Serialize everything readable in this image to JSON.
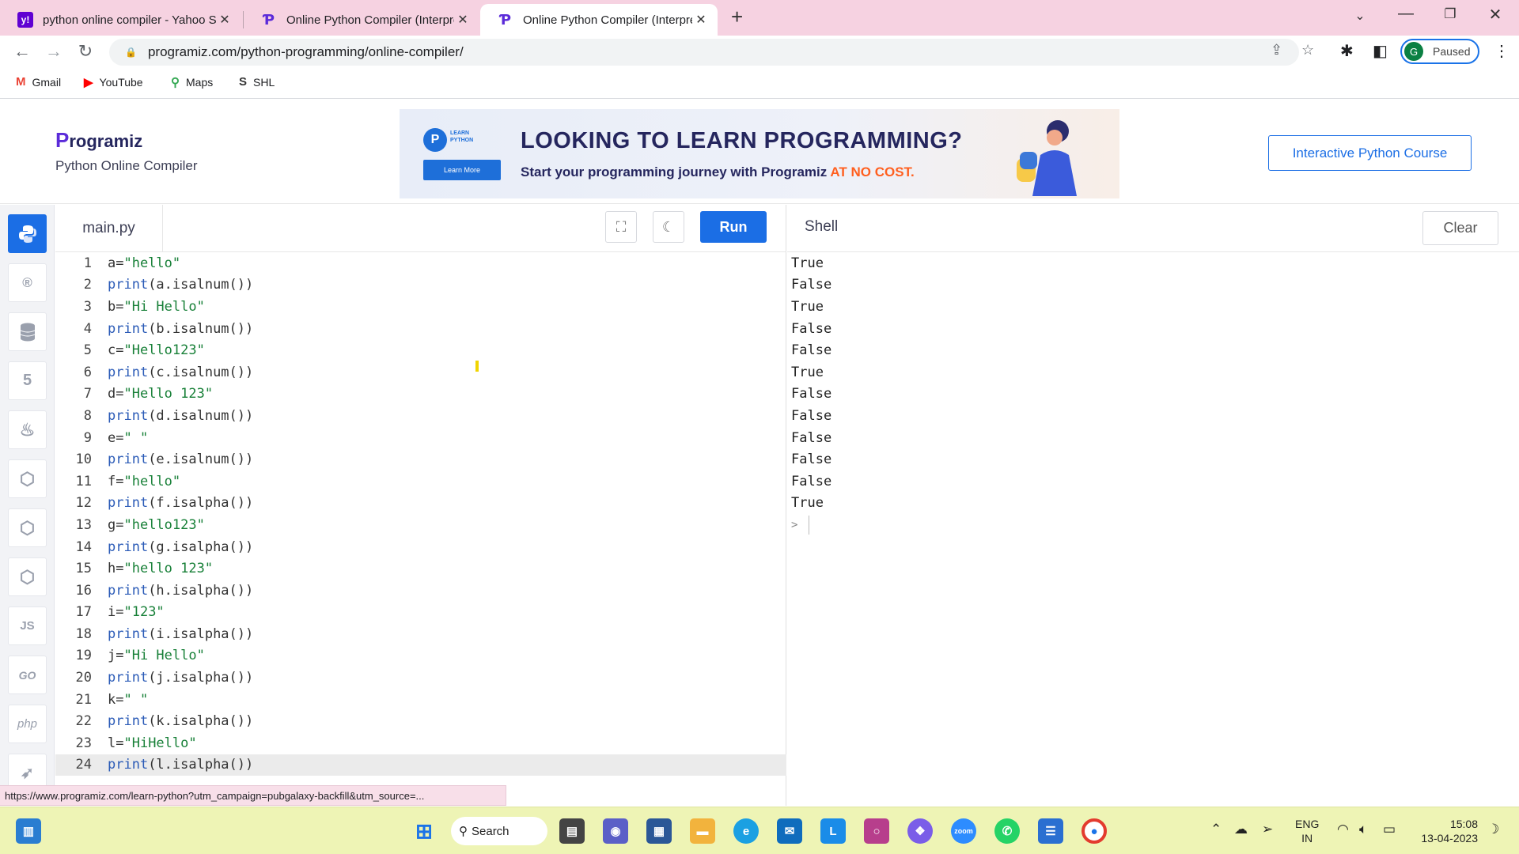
{
  "browser": {
    "tabs": [
      {
        "title": "python online compiler - Yahoo Search",
        "favicon": "yahoo-icon",
        "active": false
      },
      {
        "title": "Online Python Compiler (Interpreter)",
        "favicon": "programiz-icon",
        "active": false
      },
      {
        "title": "Online Python Compiler (Interpreter)",
        "favicon": "programiz-icon",
        "active": true
      }
    ],
    "url": "programiz.com/python-programming/online-compiler/",
    "profile_initial": "G",
    "profile_status": "Paused",
    "bookmarks": [
      {
        "label": "Gmail",
        "icon": "gmail-icon"
      },
      {
        "label": "YouTube",
        "icon": "youtube-icon"
      },
      {
        "label": "Maps",
        "icon": "maps-icon"
      },
      {
        "label": "SHL",
        "icon": "shl-icon"
      }
    ]
  },
  "header": {
    "logo": "Programiz",
    "subtitle": "Python Online Compiler",
    "banner": {
      "badge_line1": "LEARN",
      "badge_line2": "PYTHON",
      "button": "Learn More",
      "title": "LOOKING TO LEARN PROGRAMMING?",
      "subtitle": "Start your programming journey with Programiz",
      "highlight": "AT NO COST."
    },
    "course_button": "Interactive Python Course"
  },
  "sidebar": {
    "languages": [
      "python",
      "r",
      "sql",
      "html",
      "java",
      "c",
      "cplusplus",
      "csharp",
      "js",
      "go",
      "php",
      "swift"
    ],
    "labels": {
      "js": "JS",
      "go": "GO",
      "php": "php"
    }
  },
  "editor": {
    "filename": "main.py",
    "run_label": "Run",
    "lines": [
      {
        "n": "1",
        "pre": "a=",
        "call": "",
        "str": "\"hello\"",
        "rest": ""
      },
      {
        "n": "2",
        "pre": "",
        "call": "print",
        "str": "",
        "rest": "(a.isalnum())"
      },
      {
        "n": "3",
        "pre": "b=",
        "call": "",
        "str": "\"Hi Hello\"",
        "rest": ""
      },
      {
        "n": "4",
        "pre": "",
        "call": "print",
        "str": "",
        "rest": "(b.isalnum())"
      },
      {
        "n": "5",
        "pre": "c=",
        "call": "",
        "str": "\"Hello123\"",
        "rest": ""
      },
      {
        "n": "6",
        "pre": "",
        "call": "print",
        "str": "",
        "rest": "(c.isalnum())"
      },
      {
        "n": "7",
        "pre": "d=",
        "call": "",
        "str": "\"Hello 123\"",
        "rest": ""
      },
      {
        "n": "8",
        "pre": "",
        "call": "print",
        "str": "",
        "rest": "(d.isalnum())"
      },
      {
        "n": "9",
        "pre": "e=",
        "call": "",
        "str": "\" \"",
        "rest": ""
      },
      {
        "n": "10",
        "pre": "",
        "call": "print",
        "str": "",
        "rest": "(e.isalnum())"
      },
      {
        "n": "11",
        "pre": "f=",
        "call": "",
        "str": "\"hello\"",
        "rest": ""
      },
      {
        "n": "12",
        "pre": "",
        "call": "print",
        "str": "",
        "rest": "(f.isalpha())"
      },
      {
        "n": "13",
        "pre": "g=",
        "call": "",
        "str": "\"hello123\"",
        "rest": ""
      },
      {
        "n": "14",
        "pre": "",
        "call": "print",
        "str": "",
        "rest": "(g.isalpha())"
      },
      {
        "n": "15",
        "pre": "h=",
        "call": "",
        "str": "\"hello 123\"",
        "rest": ""
      },
      {
        "n": "16",
        "pre": "",
        "call": "print",
        "str": "",
        "rest": "(h.isalpha())"
      },
      {
        "n": "17",
        "pre": "i=",
        "call": "",
        "str": "\"123\"",
        "rest": ""
      },
      {
        "n": "18",
        "pre": "",
        "call": "print",
        "str": "",
        "rest": "(i.isalpha())"
      },
      {
        "n": "19",
        "pre": "j=",
        "call": "",
        "str": "\"Hi Hello\"",
        "rest": ""
      },
      {
        "n": "20",
        "pre": "",
        "call": "print",
        "str": "",
        "rest": "(j.isalpha())"
      },
      {
        "n": "21",
        "pre": "k=",
        "call": "",
        "str": "\" \"",
        "rest": ""
      },
      {
        "n": "22",
        "pre": "",
        "call": "print",
        "str": "",
        "rest": "(k.isalpha())"
      },
      {
        "n": "23",
        "pre": "l=",
        "call": "",
        "str": "\"HiHello\"",
        "rest": ""
      },
      {
        "n": "24",
        "pre": "",
        "call": "print",
        "str": "",
        "rest": "(l.isalpha())",
        "current": true
      }
    ]
  },
  "shell": {
    "title": "Shell",
    "clear_label": "Clear",
    "output": [
      "True",
      "False",
      "True",
      "False",
      "False",
      "True",
      "False",
      "False",
      "False",
      "False",
      "False",
      "True"
    ],
    "prompt": ">"
  },
  "status_url": "https://www.programiz.com/learn-python?utm_campaign=pubgalaxy-backfill&utm_source=...",
  "taskbar": {
    "search_label": "Search",
    "language_line1": "ENG",
    "language_line2": "IN",
    "time": "15:08",
    "date": "13-04-2023"
  },
  "colors": {
    "accent": "#1b6ee5",
    "tabbar": "#f6d2e1",
    "taskbar": "#eef4b5",
    "string": "#188038",
    "keyword": "#2b5bb7"
  }
}
